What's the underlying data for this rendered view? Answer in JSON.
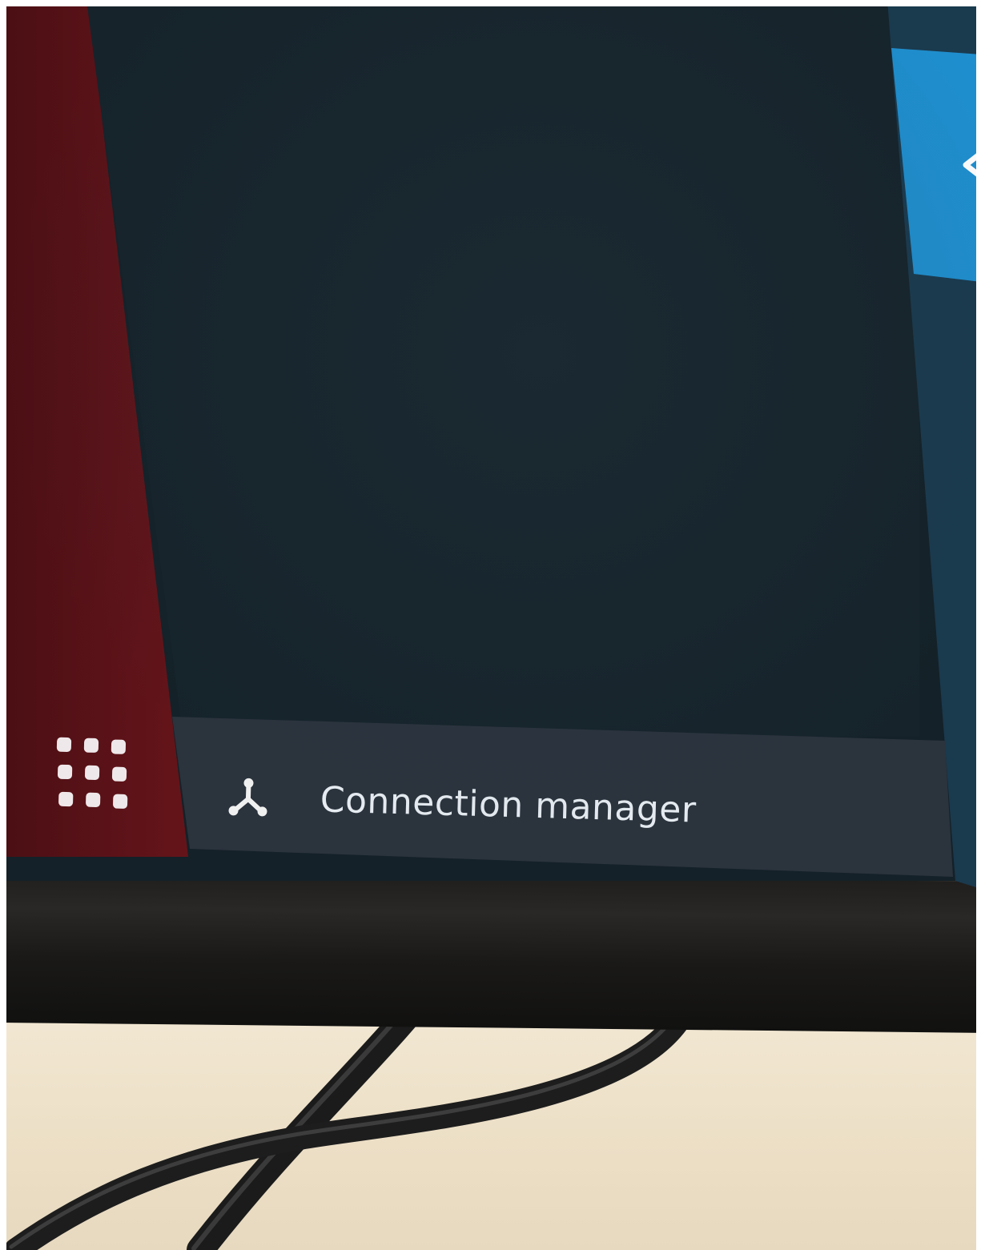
{
  "taskbar": {
    "apps_icon": "apps-grid-icon",
    "items": [
      {
        "label": "Connection manager",
        "icon": "connection-manager-icon"
      }
    ]
  },
  "colors": {
    "sidebar_accent": "#5c1218",
    "main_background": "#16232b",
    "taskbar_background": "#2b333d",
    "right_button_accent": "#1f8fcf",
    "label_text": "#e8eef3"
  }
}
